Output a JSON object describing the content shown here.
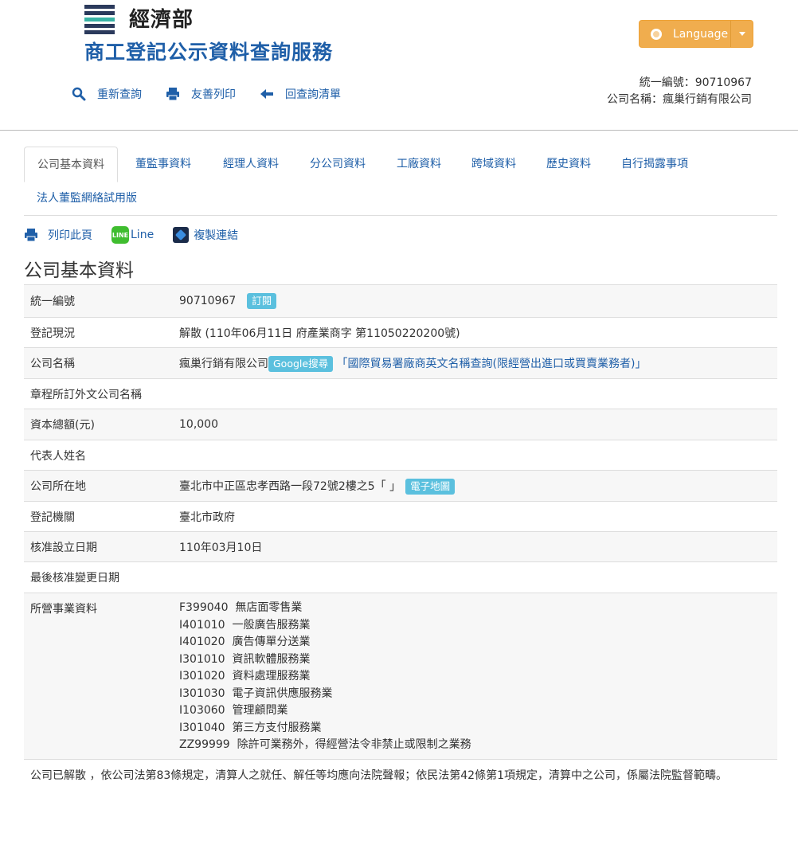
{
  "header": {
    "org_name": "經濟部",
    "site_title": "商工登記公示資料查詢服務",
    "language_label": "Language",
    "colors": {
      "title_blue": "#1f5fa8",
      "language_orange": "#f0ad4e",
      "label_cyan": "#5bc0de",
      "logo_dark": "#2b3a5c",
      "logo_teal": "#39b3a5"
    }
  },
  "topnav": {
    "requery": "重新查詢",
    "print": "友善列印",
    "back": "回查詢清單",
    "icons": [
      "search-icon",
      "print-icon",
      "arrow-left-icon"
    ]
  },
  "company_box": {
    "uid_line": "統一編號：90710967",
    "name_line": "公司名稱：瘋巢行銷有限公司"
  },
  "tabs": [
    {
      "label": "公司基本資料",
      "active": true
    },
    {
      "label": "董監事資料"
    },
    {
      "label": "經理人資料"
    },
    {
      "label": "分公司資料"
    },
    {
      "label": "工廠資料"
    },
    {
      "label": "跨域資料"
    },
    {
      "label": "歷史資料"
    },
    {
      "label": "自行揭露事項"
    },
    {
      "label": "法人董監網絡試用版"
    }
  ],
  "tools": {
    "print_page": "列印此頁",
    "line": "Line",
    "line_icon_text": "LINE",
    "copy_link": "複製連結"
  },
  "section_title": "公司基本資料",
  "basic_info": {
    "uid": {
      "label": "統一編號",
      "value": "90710967",
      "badge": "訂閱"
    },
    "status": {
      "label": "登記現況",
      "value": "解散 (110年06月11日 府產業商字 第11050220200號)"
    },
    "name": {
      "label": "公司名稱",
      "value": "瘋巢行銷有限公司",
      "badge": "Google搜尋",
      "link": "「國際貿易署廠商英文名稱查詢(限經營出進口或買賣業務者)」"
    },
    "foreign_name": {
      "label": "章程所訂外文公司名稱",
      "value": ""
    },
    "capital": {
      "label": "資本總額(元)",
      "value": "10,000"
    },
    "representative": {
      "label": "代表人姓名",
      "value": ""
    },
    "address": {
      "label": "公司所在地",
      "value": "臺北市中正區忠孝西路一段72號2樓之5「 」",
      "badge": "電子地圖"
    },
    "authority": {
      "label": "登記機關",
      "value": "臺北市政府"
    },
    "established": {
      "label": "核准設立日期",
      "value": "110年03月10日"
    },
    "last_change": {
      "label": "最後核准變更日期",
      "value": ""
    },
    "business": {
      "label": "所營事業資料",
      "items": [
        "F399040  無店面零售業",
        "I401010  一般廣告服務業",
        "I401020  廣告傳單分送業",
        "I301010  資訊軟體服務業",
        "I301020  資料處理服務業",
        "I301030  電子資訊供應服務業",
        "I103060  管理顧問業",
        "I301040  第三方支付服務業",
        "ZZ99999  除許可業務外，得經營法令非禁止或限制之業務"
      ]
    }
  },
  "notice": "公司已解散 ，依公司法第83條規定，清算人之就任、解任等均應向法院聲報；依民法第42條第1項規定，清算中之公司，係屬法院監督範疇。"
}
